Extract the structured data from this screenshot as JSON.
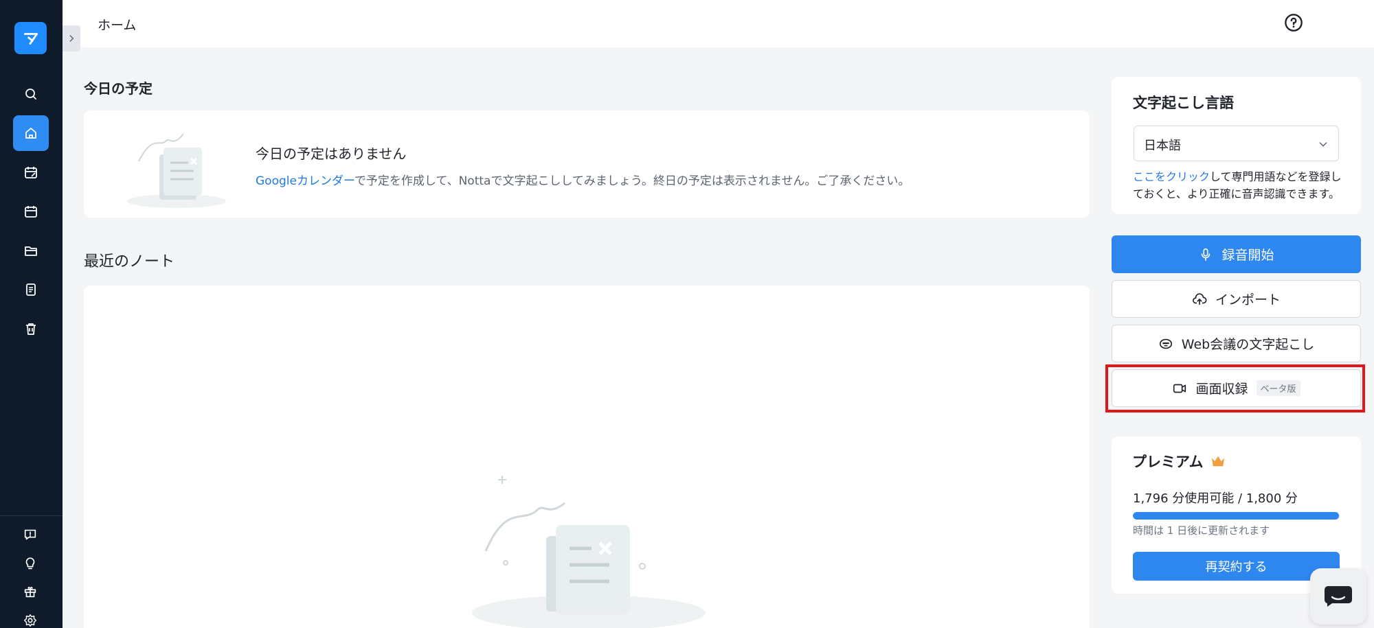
{
  "header": {
    "breadcrumb": "ホーム"
  },
  "schedule": {
    "title": "今日の予定",
    "empty_heading": "今日の予定はありません",
    "empty_link": "Googleカレンダー",
    "empty_text": "で予定を作成して、Nottaで文字起こししてみましょう。終日の予定は表示されません。ご了承ください。"
  },
  "recent": {
    "title": "最近のノート"
  },
  "language": {
    "title": "文字起こし言語",
    "selected": "日本語",
    "hint_link": "ここをクリック",
    "hint_text": "して専門用語などを登録しておくと、より正確に音声認識できます。"
  },
  "actions": {
    "record": "録音開始",
    "import": "インポート",
    "web_meeting": "Web会議の文字起こし",
    "screen_record": "画面収録",
    "beta": "ベータ版"
  },
  "premium": {
    "title": "プレミアム",
    "usage": "1,796 分使用可能 / 1,800 分",
    "usage_fraction": 0.9978,
    "reset_note": "時間は 1 日後に更新されます",
    "renew": "再契約する"
  },
  "colors": {
    "accent": "#2e86ef",
    "sidebar": "#0f1b2a",
    "highlight": "#e3161b"
  }
}
